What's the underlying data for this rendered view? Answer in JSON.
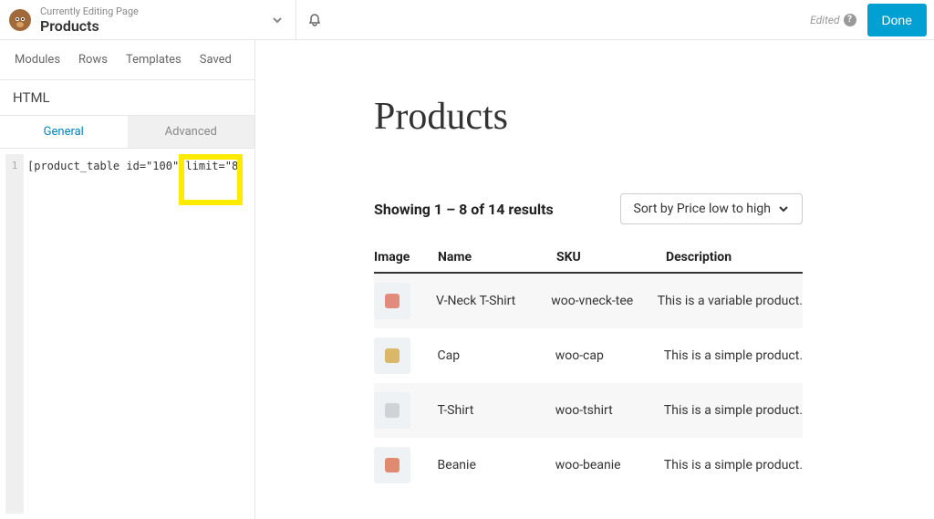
{
  "header": {
    "editing_label": "Currently Editing Page",
    "page_title": "Products",
    "edited_label": "Edited",
    "done_label": "Done"
  },
  "sidebar": {
    "tabs1": {
      "modules": "Modules",
      "rows": "Rows",
      "templates": "Templates",
      "saved": "Saved"
    },
    "panel_title": "HTML",
    "tabs2": {
      "general": "General",
      "advanced": "Advanced"
    },
    "gutter_line": "1",
    "code_text": "[product_table id=\"100\" limit=\"8"
  },
  "content": {
    "title": "Products",
    "results_text": "Showing 1 – 8 of 14 results",
    "sort_label": "Sort by Price low to high",
    "columns": {
      "image": "Image",
      "name": "Name",
      "sku": "SKU",
      "description": "Description"
    },
    "rows": [
      {
        "name": "V-Neck T-Shirt",
        "sku": "woo-vneck-tee",
        "desc": "This is a variable product.",
        "color": "#e28b7d"
      },
      {
        "name": "Cap",
        "sku": "woo-cap",
        "desc": "This is a simple product.",
        "color": "#d9b86a"
      },
      {
        "name": "T-Shirt",
        "sku": "woo-tshirt",
        "desc": "This is a simple product.",
        "color": "#cfd2d6"
      },
      {
        "name": "Beanie",
        "sku": "woo-beanie",
        "desc": "This is a simple product.",
        "color": "#e08a72"
      }
    ]
  }
}
